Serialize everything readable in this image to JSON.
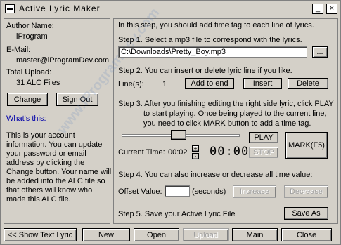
{
  "window": {
    "title": "Active Lyric Maker",
    "minimize": "_",
    "close": "×"
  },
  "left": {
    "author_label": "Author Name:",
    "author_value": "iProgram",
    "email_label": "E-Mail:",
    "email_value": "master@iProgramDev.com",
    "upload_label": "Total Upload:",
    "upload_value": "31 ALC Files",
    "change_btn": "Change",
    "signout_btn": "Sign Out",
    "whats_this": "What's this:",
    "help_text": "This is your account information. You can update your password or email address by clicking the Change button. Your name will be added into the ALC file so that others will know who made this ALC file."
  },
  "right": {
    "intro": "In this step, you should add time tag to each line of lyrics.",
    "step1": "Step 1. Select a mp3 file to correspond with the lyrics.",
    "file_path": "C:\\Downloads\\Pretty_Boy.mp3",
    "browse_btn": "...",
    "step2": "Step 2. You can insert or delete lyric line if you like.",
    "lines_label": "Line(s):",
    "lines_value": "1",
    "add_end_btn": "Add to end",
    "insert_btn": "Insert",
    "delete_btn": "Delete",
    "step3_line1": "Step 3. After you finishing editing the right side lyric, click PLAY",
    "step3_line2": "to start playing. Once being played to the current line,",
    "step3_line3": "you need to click MARK button to add a time tag.",
    "play_btn": "PLAY",
    "stop_btn": "STOP",
    "mark_btn": "MARK(F5)",
    "current_time_label": "Current Time:",
    "current_time_value": "00:02",
    "spin_up": "+",
    "spin_down": "-",
    "lcd_time": "00:00",
    "step4": "Step 4. You can also increase or decrease all time value:",
    "offset_label": "Offset Value:",
    "offset_value": "",
    "seconds_label": "(seconds)",
    "increase_btn": "Increase",
    "decrease_btn": "Decrease",
    "step5": "Step 5. Save your Active Lyric File",
    "saveas_btn": "Save As"
  },
  "watermark": "www.iProgramDev.com",
  "bottom": {
    "show_text_btn": "<< Show Text Lyric",
    "new_btn": "New",
    "open_btn": "Open",
    "upload_btn": "Upload",
    "main_btn": "Main",
    "close_btn": "Close"
  },
  "playback": {
    "position_fraction": 0.48
  }
}
